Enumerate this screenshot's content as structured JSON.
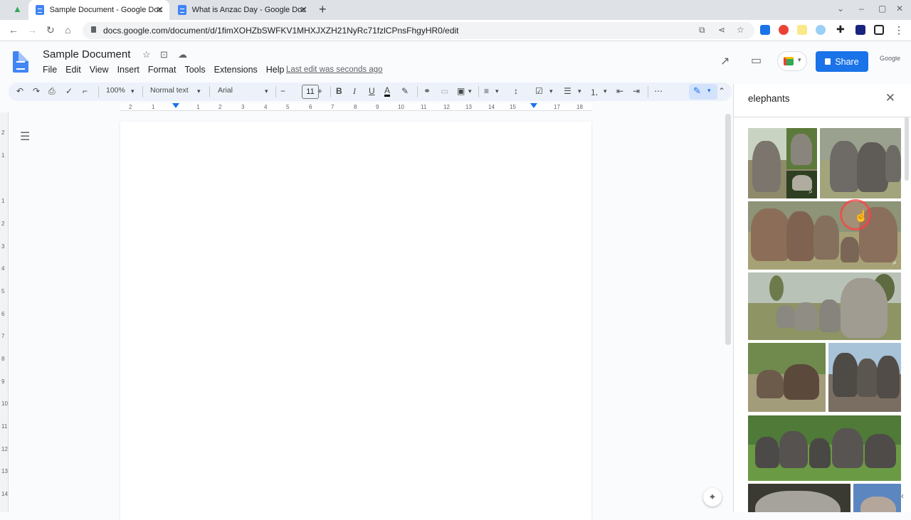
{
  "browser": {
    "tabs": [
      {
        "label": "Sample Document - Google Docs",
        "close": "✕"
      },
      {
        "label": "What is Anzac Day - Google Docs",
        "close": "✕"
      }
    ],
    "new_tab": "+",
    "url": "docs.google.com/document/d/1fimXOHZbSWFKV1MHXJXZH21NyRc71fzlCPnsFhgyHR0/edit",
    "window_controls": [
      "⌄",
      "–",
      "▢",
      "✕"
    ]
  },
  "doc": {
    "title": "Sample Document",
    "menus": [
      "File",
      "Edit",
      "View",
      "Insert",
      "Format",
      "Tools",
      "Extensions",
      "Help"
    ],
    "last_edit": "Last edit was seconds ago",
    "share_label": "Share",
    "google_edu": "Google"
  },
  "toolbar": {
    "zoom": "100%",
    "style": "Normal text",
    "font": "Arial",
    "font_size": "11",
    "minus": "−",
    "plus": "+",
    "bold": "B",
    "italic": "I",
    "underline": "U",
    "text_color": "A"
  },
  "ruler": {
    "numbers": [
      "2",
      "1",
      "1",
      "2",
      "3",
      "4",
      "5",
      "6",
      "7",
      "8",
      "9",
      "10",
      "11",
      "12",
      "13",
      "14",
      "15",
      "16",
      "17",
      "18"
    ]
  },
  "ruler_left": {
    "numbers": [
      "2",
      "1",
      "1",
      "2",
      "3",
      "4",
      "5",
      "6",
      "7",
      "8",
      "9",
      "10",
      "11",
      "12",
      "13",
      "14"
    ]
  },
  "side_panel": {
    "query": "elephants",
    "close": "✕"
  },
  "colors": {
    "accent": "#1a73e8",
    "toolbar_bg": "#edf2fa",
    "page_bg": "#f9fbfd"
  }
}
